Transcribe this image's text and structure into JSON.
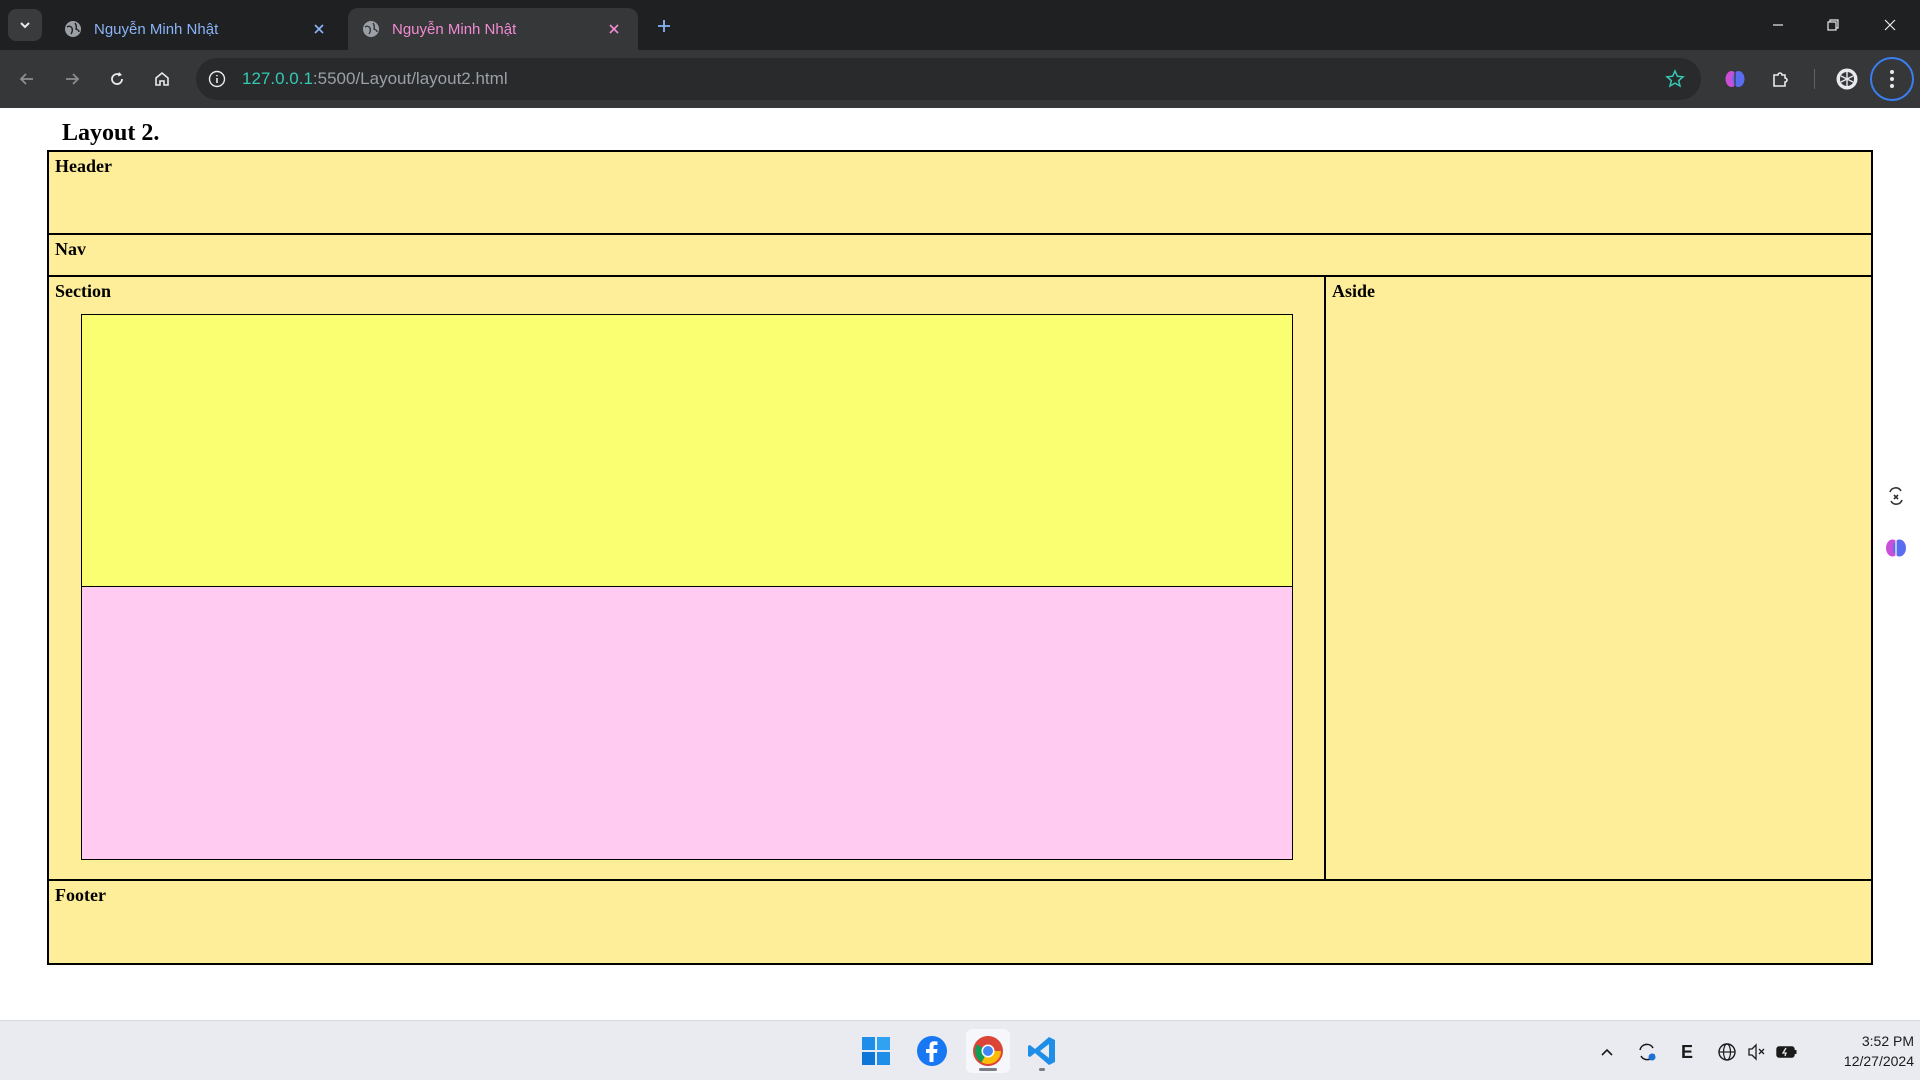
{
  "browser": {
    "tabs": [
      {
        "title": "Nguyễn Minh Nhật",
        "active": false
      },
      {
        "title": "Nguyễn Minh Nhật",
        "active": true
      }
    ],
    "url_host": "127.0.0.1",
    "url_rest": ":5500/Layout/layout2.html"
  },
  "page": {
    "title": "Layout 2.",
    "header_label": "Header",
    "nav_label": "Nav",
    "section_label": "Section",
    "aside_label": "Aside",
    "footer_label": "Footer"
  },
  "colors": {
    "block": "#ffee99",
    "inner_top": "#f9ff70",
    "inner_bottom": "#ffcbf0",
    "tab_inactive_text": "#8ab4f8",
    "tab_active_text": "#f28bd4",
    "url_host": "#35c9b4"
  },
  "taskbar": {
    "apps": [
      "windows-start",
      "facebook",
      "chrome",
      "vscode"
    ],
    "tray_letter": "E",
    "time": "3:52 PM",
    "date": "12/27/2024"
  }
}
